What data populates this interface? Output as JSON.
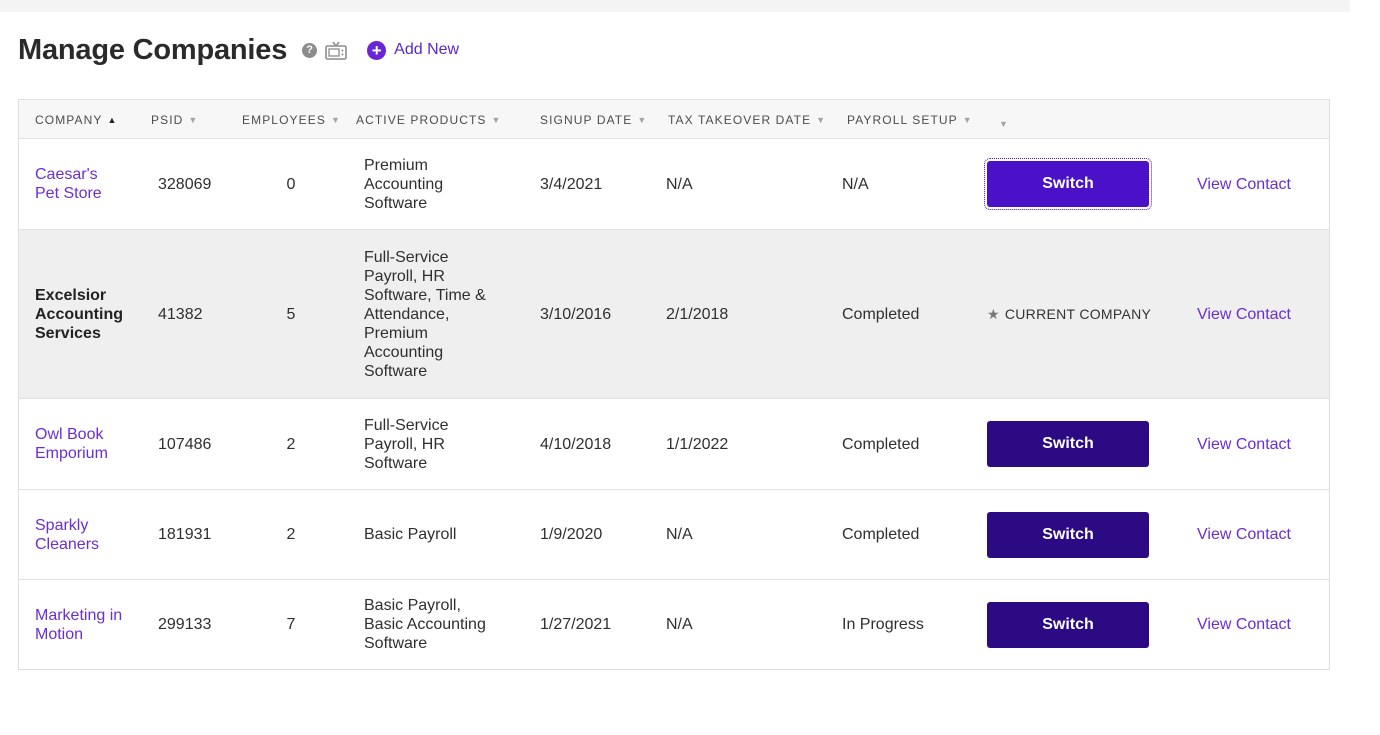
{
  "header": {
    "title": "Manage Companies",
    "help_icon": "?",
    "add_new_icon": "+",
    "add_new_label": "Add New"
  },
  "table": {
    "columns": [
      {
        "label": "Company",
        "sort": "▲"
      },
      {
        "label": "PSID",
        "sort": "▼"
      },
      {
        "label": "Employees",
        "sort": "▼"
      },
      {
        "label": "Active Products",
        "sort": "▼"
      },
      {
        "label": "Signup Date",
        "sort": "▼"
      },
      {
        "label": "Tax Takeover Date",
        "sort": "▼"
      },
      {
        "label": "Payroll Setup",
        "sort": "▼"
      },
      {
        "label": "",
        "sort": "▼"
      }
    ],
    "rows": [
      {
        "company": "Caesar's Pet Store",
        "psid": "328069",
        "employees": "0",
        "products": "Premium Accounting Software",
        "signup": "3/4/2021",
        "tax": "N/A",
        "payroll": "N/A",
        "action": "Switch",
        "contact": "View Contact"
      },
      {
        "company": "Excelsior Accounting Services",
        "psid": "41382",
        "employees": "5",
        "products": "Full-Service Payroll, HR Software, Time & Attendance, Premium Accounting Software",
        "signup": "3/10/2016",
        "tax": "2/1/2018",
        "payroll": "Completed",
        "star": "★",
        "action": "CURRENT COMPANY",
        "contact": "View Contact"
      },
      {
        "company": "Owl Book Emporium",
        "psid": "107486",
        "employees": "2",
        "products": "Full-Service Payroll, HR Software",
        "signup": "4/10/2018",
        "tax": "1/1/2022",
        "payroll": "Completed",
        "action": "Switch",
        "contact": "View Contact"
      },
      {
        "company": "Sparkly Cleaners",
        "psid": "181931",
        "employees": "2",
        "products": "Basic Payroll",
        "signup": "1/9/2020",
        "tax": "N/A",
        "payroll": "Completed",
        "action": "Switch",
        "contact": "View Contact"
      },
      {
        "company": "Marketing in Motion",
        "psid": "299133",
        "employees": "7",
        "products": "Basic Payroll, Basic Accounting Software",
        "signup": "1/27/2021",
        "tax": "N/A",
        "payroll": "In Progress",
        "action": "Switch",
        "contact": "View Contact"
      }
    ]
  },
  "colors": {
    "accent": "#6a2fd0",
    "button": "#2b0a84",
    "button_focused": "#4a11c9"
  }
}
